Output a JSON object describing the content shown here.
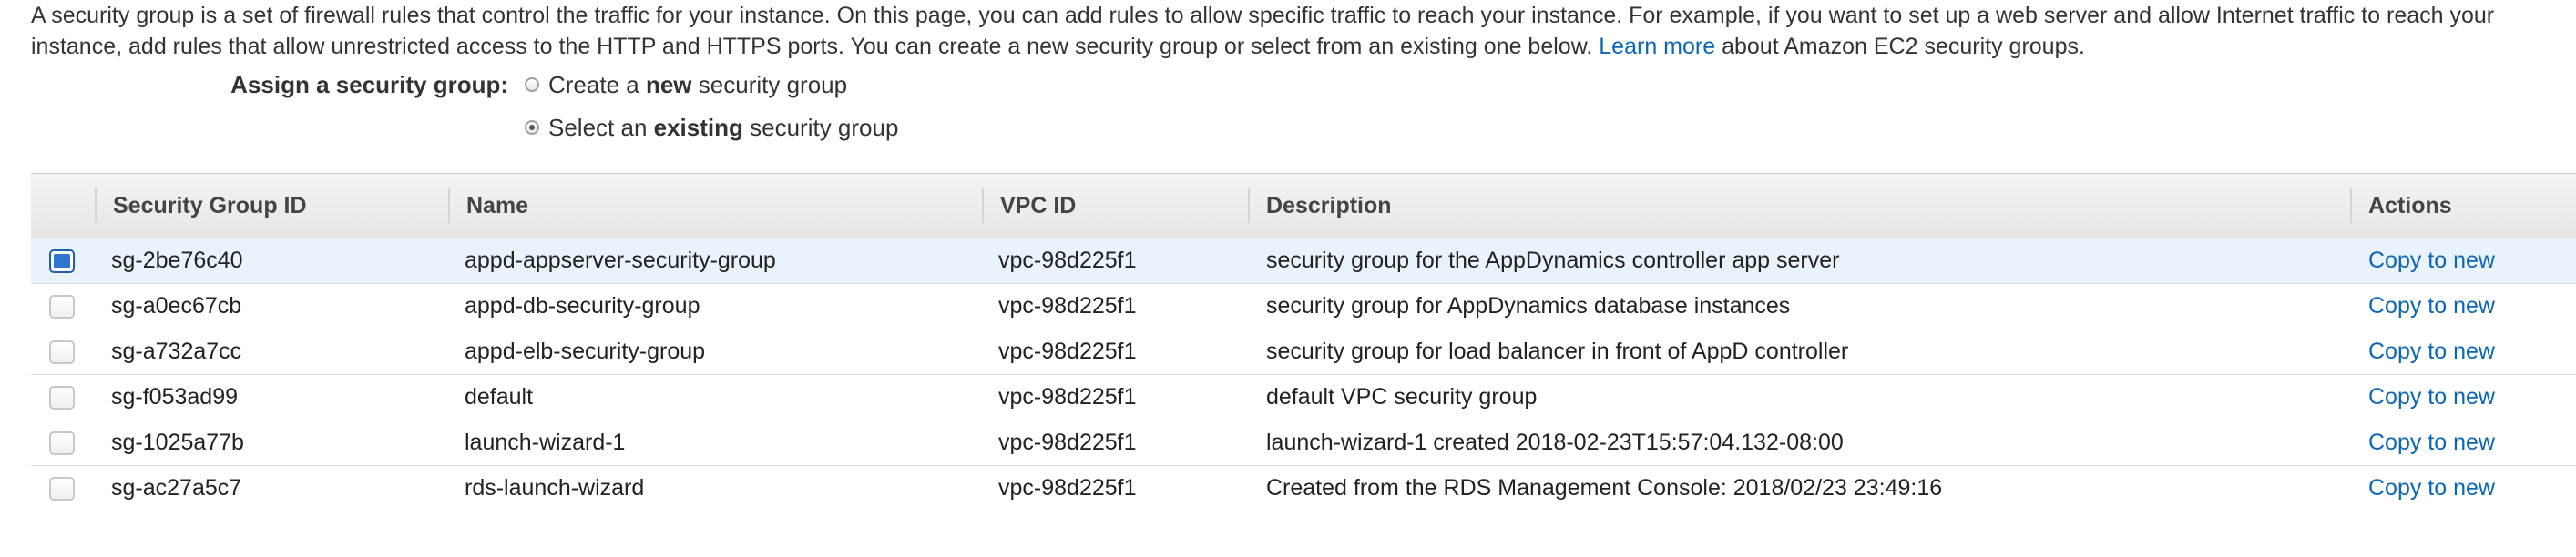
{
  "intro": {
    "text_before_link": "A security group is a set of firewall rules that control the traffic for your instance. On this page, you can add rules to allow specific traffic to reach your instance. For example, if you want to set up a web server and allow Internet traffic to reach your instance, add rules that allow unrestricted access to the HTTP and HTTPS ports. You can create a new security group or select from an existing one below.",
    "link_text": "Learn more",
    "text_after_link": "about Amazon EC2 security groups."
  },
  "assign": {
    "label": "Assign a security group:",
    "options": [
      {
        "prefix": "Create a",
        "bold": "new",
        "suffix": "security group",
        "selected": false
      },
      {
        "prefix": "Select an",
        "bold": "existing",
        "suffix": "security group",
        "selected": true
      }
    ]
  },
  "table": {
    "headers": {
      "id": "Security Group ID",
      "name": "Name",
      "vpc": "VPC ID",
      "description": "Description",
      "actions": "Actions"
    },
    "rows": [
      {
        "id": "sg-2be76c40",
        "name": "appd-appserver-security-group",
        "vpc": "vpc-98d225f1",
        "description": "security group for the AppDynamics controller app server",
        "action": "Copy to new",
        "selected": true
      },
      {
        "id": "sg-a0ec67cb",
        "name": "appd-db-security-group",
        "vpc": "vpc-98d225f1",
        "description": "security group for AppDynamics database instances",
        "action": "Copy to new",
        "selected": false
      },
      {
        "id": "sg-a732a7cc",
        "name": "appd-elb-security-group",
        "vpc": "vpc-98d225f1",
        "description": "security group for load balancer in front of AppD controller",
        "action": "Copy to new",
        "selected": false
      },
      {
        "id": "sg-f053ad99",
        "name": "default",
        "vpc": "vpc-98d225f1",
        "description": "default VPC security group",
        "action": "Copy to new",
        "selected": false
      },
      {
        "id": "sg-1025a77b",
        "name": "launch-wizard-1",
        "vpc": "vpc-98d225f1",
        "description": "launch-wizard-1 created 2018-02-23T15:57:04.132-08:00",
        "action": "Copy to new",
        "selected": false
      },
      {
        "id": "sg-ac27a5c7",
        "name": "rds-launch-wizard",
        "vpc": "vpc-98d225f1",
        "description": "Created from the RDS Management Console: 2018/02/23 23:49:16",
        "action": "Copy to new",
        "selected": false
      }
    ]
  },
  "colors": {
    "link": "#0b66b5",
    "selected_row": "#eaf2fb",
    "checkbox_checked": "#2f74d0"
  }
}
